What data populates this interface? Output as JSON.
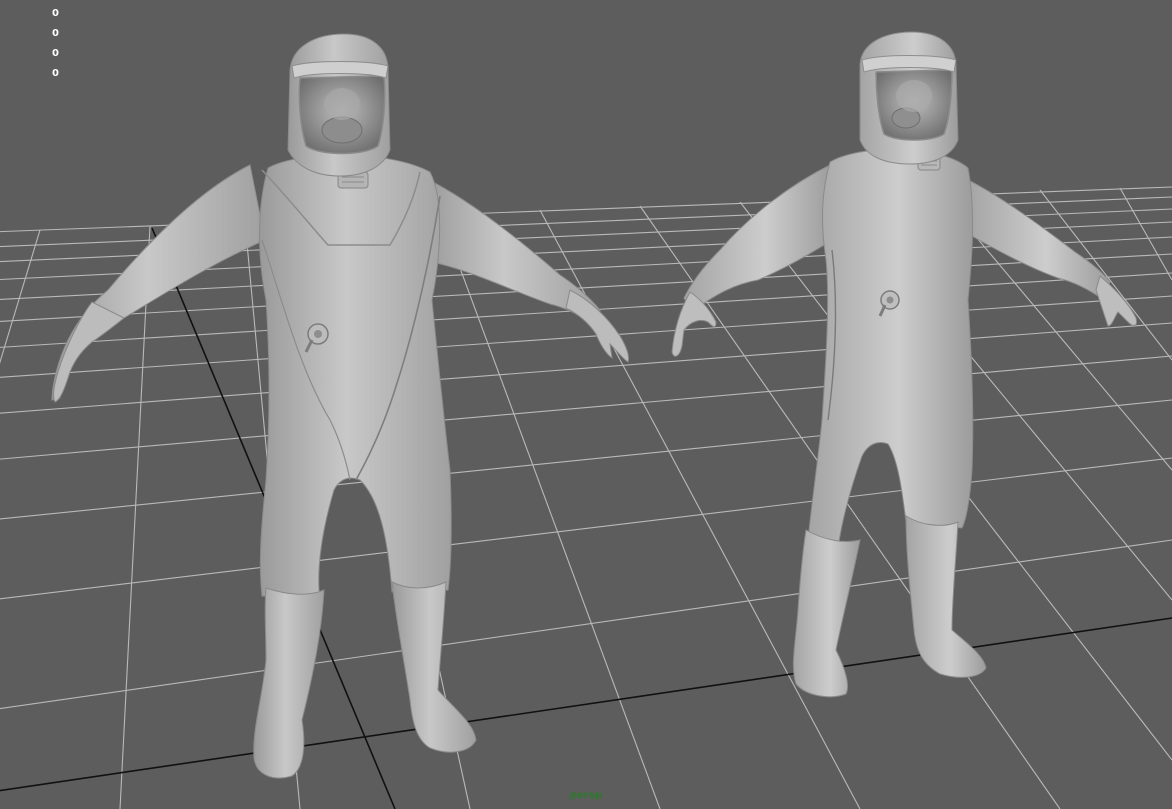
{
  "viewport": {
    "camera_name": "persp",
    "hud_stats": [
      "0",
      "0",
      "0",
      "0"
    ],
    "background_color": "#5d5d5d",
    "grid_color": "#b9b9b9",
    "axis_color": "#111111",
    "mesh_color": "#c2c2c2"
  },
  "models": [
    {
      "name": "hazmat-suit-model-front"
    },
    {
      "name": "hazmat-suit-model-angled"
    }
  ]
}
